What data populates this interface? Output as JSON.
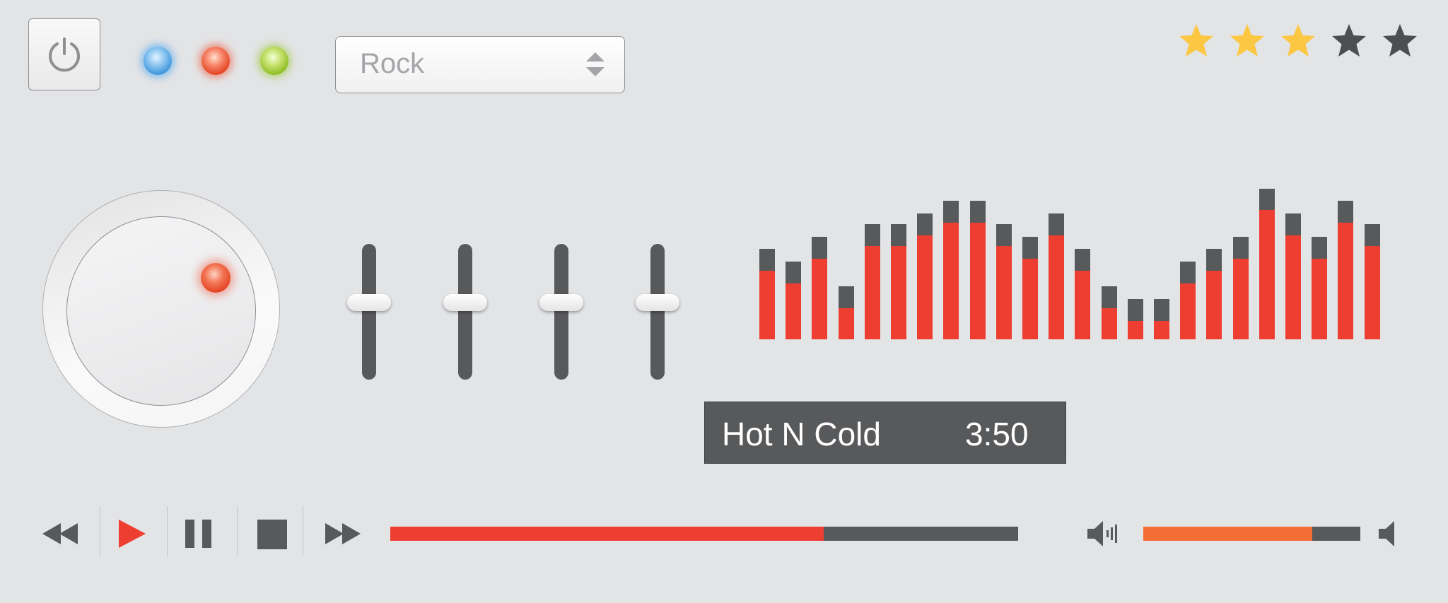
{
  "genre": {
    "selected": "Rock"
  },
  "rating": {
    "value": 3,
    "max": 5,
    "filled_color": "#fcc844",
    "empty_color": "#4d4e50"
  },
  "indicators": [
    {
      "name": "blue-led",
      "color": "#3a93d8"
    },
    {
      "name": "red-led",
      "color": "#e2401f"
    },
    {
      "name": "green-led",
      "color": "#8dbb22"
    }
  ],
  "equalizer_sliders": [
    0.57,
    0.57,
    0.57,
    0.57
  ],
  "spectrum": {
    "bars": [
      {
        "level": 0.44,
        "cap": 0.14
      },
      {
        "level": 0.36,
        "cap": 0.14
      },
      {
        "level": 0.52,
        "cap": 0.14
      },
      {
        "level": 0.2,
        "cap": 0.14
      },
      {
        "level": 0.6,
        "cap": 0.14
      },
      {
        "level": 0.6,
        "cap": 0.14
      },
      {
        "level": 0.67,
        "cap": 0.14
      },
      {
        "level": 0.75,
        "cap": 0.14
      },
      {
        "level": 0.75,
        "cap": 0.14
      },
      {
        "level": 0.6,
        "cap": 0.14
      },
      {
        "level": 0.52,
        "cap": 0.14
      },
      {
        "level": 0.67,
        "cap": 0.14
      },
      {
        "level": 0.44,
        "cap": 0.14
      },
      {
        "level": 0.2,
        "cap": 0.14
      },
      {
        "level": 0.12,
        "cap": 0.14
      },
      {
        "level": 0.12,
        "cap": 0.14
      },
      {
        "level": 0.36,
        "cap": 0.14
      },
      {
        "level": 0.44,
        "cap": 0.14
      },
      {
        "level": 0.52,
        "cap": 0.14
      },
      {
        "level": 0.83,
        "cap": 0.14
      },
      {
        "level": 0.67,
        "cap": 0.14
      },
      {
        "level": 0.52,
        "cap": 0.14
      },
      {
        "level": 0.75,
        "cap": 0.14
      },
      {
        "level": 0.6,
        "cap": 0.14
      }
    ],
    "fill_color": "#ee3e31",
    "cap_color": "#58595b"
  },
  "track": {
    "title": "Hot N Cold",
    "duration": "3:50"
  },
  "playback": {
    "progress": 0.69,
    "volume": 0.78
  },
  "colors": {
    "accent": "#ee3e31",
    "volume": "#f26e35",
    "dark": "#58595b",
    "background": "#e3e4e6"
  }
}
